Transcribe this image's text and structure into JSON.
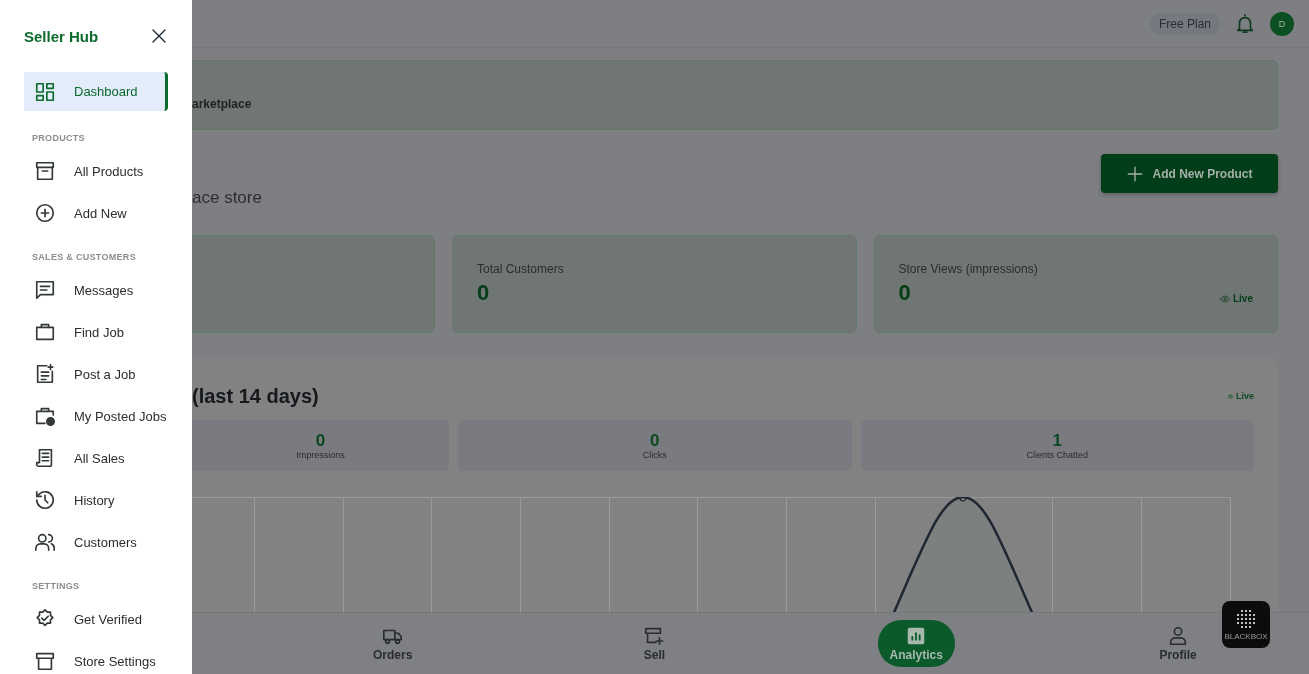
{
  "sidebar": {
    "title": "Seller Hub",
    "items": [
      {
        "kind": "item",
        "label": "Dashboard",
        "selected": true
      },
      {
        "kind": "section",
        "label": "PRODUCTS"
      },
      {
        "kind": "item",
        "label": "All Products",
        "selected": false
      },
      {
        "kind": "item",
        "label": "Add New",
        "selected": false
      },
      {
        "kind": "section",
        "label": "SALES & CUSTOMERS"
      },
      {
        "kind": "item",
        "label": "Messages",
        "selected": false
      },
      {
        "kind": "item",
        "label": "Find Job",
        "selected": false
      },
      {
        "kind": "item",
        "label": "Post a Job",
        "selected": false
      },
      {
        "kind": "item",
        "label": "My Posted Jobs",
        "selected": false
      },
      {
        "kind": "item",
        "label": "All Sales",
        "selected": false
      },
      {
        "kind": "item",
        "label": "History",
        "selected": false
      },
      {
        "kind": "item",
        "label": "Customers",
        "selected": false
      },
      {
        "kind": "section",
        "label": "SETTINGS"
      },
      {
        "kind": "item",
        "label": "Get Verified",
        "selected": false
      },
      {
        "kind": "item",
        "label": "Store Settings",
        "selected": false
      }
    ]
  },
  "header": {
    "plan_badge": "Free Plan",
    "avatar": "D"
  },
  "banner": {
    "text": "arketplace"
  },
  "store": {
    "subtitle": "ace store",
    "add_button": "Add New Product"
  },
  "stat_cards": [
    {
      "kind": "empty"
    },
    {
      "kind": "stat",
      "label": "Total Customers",
      "value": "0"
    },
    {
      "kind": "stat",
      "label": "Store Views (impressions)",
      "value": "0",
      "badge": "Live"
    }
  ],
  "analytics": {
    "title": "(last 14 days)",
    "badge": "Live",
    "metrics": [
      {
        "value": "0",
        "label": "Impressions"
      },
      {
        "value": "0",
        "label": "Clicks"
      },
      {
        "value": "1",
        "label": "Clients Chatted"
      }
    ]
  },
  "bottom_nav": [
    {
      "label": "Orders",
      "selected": false
    },
    {
      "label": "Sell",
      "selected": false
    },
    {
      "label": "Analytics",
      "selected": true
    },
    {
      "label": "Profile",
      "selected": false
    }
  ],
  "widget": {
    "label": "BLACKBOX"
  }
}
